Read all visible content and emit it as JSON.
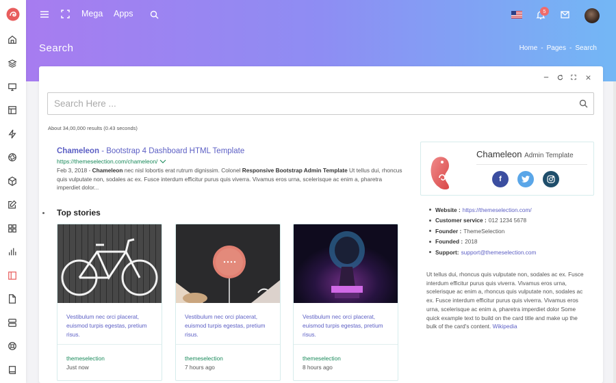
{
  "topbar": {
    "menu_mega": "Mega",
    "menu_apps": "Apps",
    "notification_count": "5",
    "language_flag": "flag-us-icon"
  },
  "page": {
    "title": "Search",
    "breadcrumb": [
      "Home",
      "-",
      "Pages",
      "-",
      "Search"
    ]
  },
  "search": {
    "placeholder": "Search Here ...",
    "value": "",
    "result_count": "About 34,00,000 results (0.43 seconds)"
  },
  "result": {
    "title_bold": "Chameleon",
    "title_rest": " - Bootstrap 4 Dashboard HTML Template",
    "url": "https://themeselection.com/chameleon/",
    "snippet_date": "Feb 3, 2018 - ",
    "snippet_b1": "Chameleon",
    "snippet_t1": " nec nisl lobortis erat rutrum dignissim. Colonel ",
    "snippet_b2": "Responsive Bootstrap Admin Template",
    "snippet_t2": " Ut tellus dui, rhoncus quis vulputate non, sodales ac ex. Fusce interdum efficitur purus quis viverra. Vivamus eros urna, scelerisque ac enim a, pharetra imperdiet dolor..."
  },
  "top_stories": {
    "heading": "Top stories",
    "items": [
      {
        "link": "Vestibulum nec orci placerat, euismod turpis egestas, pretium risus.",
        "source": "themeselection",
        "time": "Just now"
      },
      {
        "link": "Vestibulum nec orci placerat, euismod turpis egestas, pretium risus.",
        "source": "themeselection",
        "time": "7 hours ago"
      },
      {
        "link": "Vestibulum nec orci placerat, euismod turpis egestas, pretium risus.",
        "source": "themeselection",
        "time": "8 hours ago"
      }
    ]
  },
  "knowledge_panel": {
    "name": "Chameleon",
    "subtitle": "Admin Template",
    "social": [
      "facebook-icon",
      "twitter-icon",
      "instagram-icon"
    ],
    "facts": [
      {
        "label": "Website :",
        "value": "https://themeselection.com/"
      },
      {
        "label": "Customer service :",
        "value": "012 1234 5678"
      },
      {
        "label": "Founder :",
        "value": "ThemeSelection"
      },
      {
        "label": "Founded :",
        "value": "2018"
      },
      {
        "label": "Support:",
        "value": "support@themeselection.com"
      }
    ],
    "description": "Ut tellus dui, rhoncus quis vulputate non, sodales ac ex. Fusce interdum efficitur purus quis viverra. Vivamus eros urna, scelerisque ac enim a, rhoncus quis vulputate non, sodales ac ex. Fusce interdum efficitur purus quis viverra. Vivamus eros urna, scelerisque ac enim a, pharetra imperdiet dolor Some quick example text to build on the card title and make up the bulk of the card's content.",
    "wiki_link": "Wikipedia"
  },
  "colors": {
    "accent": "#5c5fc4",
    "url_green": "#1a8a5b",
    "brand_red": "#e85d5d",
    "facebook": "#3b4ea0",
    "twitter": "#5aa6e8",
    "instagram": "#1f4e6b"
  }
}
